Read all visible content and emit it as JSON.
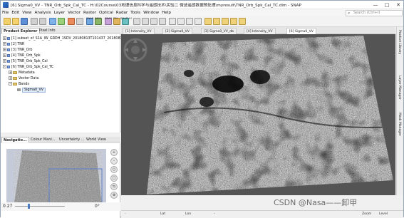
{
  "window": {
    "title": "[6] Sigma0_VV - TNR_Orb_Spk_Cal_TC - H:\\02Course\\03地理信息科学与遥感技术\\实验二 微波遥感数据预处理\\myresult\\TNR_Orb_Spk_Cal_TC.dim - SNAP",
    "min": "—",
    "max": "□",
    "close": "✕"
  },
  "menu": [
    "File",
    "Edit",
    "View",
    "Analysis",
    "Layer",
    "Vector",
    "Raster",
    "Optical",
    "Radar",
    "Tools",
    "Window",
    "Help"
  ],
  "search": {
    "placeholder": "Search (Ctrl+I)"
  },
  "toolbar": {
    "labels": [
      "SNAP",
      "DEM",
      "SBAS",
      "PSI",
      "SNAPHU"
    ]
  },
  "left_tabs": {
    "product_explorer": "Product Explorer",
    "pixel_info": "Pixel Info"
  },
  "tree": [
    {
      "num": "[1]",
      "name": "subset_of_S1A_IW_GRDH_1SDV_20180813T101437_20180813T10",
      "kind": "product"
    },
    {
      "num": "[2]",
      "name": "TNR",
      "kind": "product"
    },
    {
      "num": "[3]",
      "name": "TNR_Orb",
      "kind": "product"
    },
    {
      "num": "[4]",
      "name": "TNR_Orb_Spk",
      "kind": "product"
    },
    {
      "num": "[5]",
      "name": "TNR_Orb_Spk_Cal",
      "kind": "product"
    },
    {
      "num": "[6]",
      "name": "TNR_Orb_Spk_Cal_TC",
      "kind": "product"
    },
    {
      "num": "",
      "name": "Metadata",
      "kind": "folder"
    },
    {
      "num": "",
      "name": "Vector Data",
      "kind": "folder"
    },
    {
      "num": "",
      "name": "Bands",
      "kind": "folder"
    },
    {
      "num": "",
      "name": "Sigma0_VV",
      "kind": "band"
    }
  ],
  "nav_tabs": {
    "navigation": "Navigatio...",
    "colour": "Colour Mani...",
    "uncertainty": "Uncertainty ...",
    "world": "World View"
  },
  "nav": {
    "zoom_value": "0.27",
    "rotation_value": "0°"
  },
  "view_tabs": [
    "[1] Intensity_VV",
    "[2] Sigma0_VV",
    "[3] Sigma0_VV_db",
    "[4] Intensity_VV",
    "[6] Sigma0_VV"
  ],
  "right_panels": [
    "Product Library",
    "Layer Manager",
    "Mask Manager"
  ],
  "status": {
    "lat": "Lat",
    "lon": "Lon",
    "zoom": "Zoom",
    "level": "Level"
  },
  "watermark": "CSDN @Nasa——卸甲",
  "colors": {
    "image_bg": "#545454",
    "accent": "#3a7bd5"
  }
}
